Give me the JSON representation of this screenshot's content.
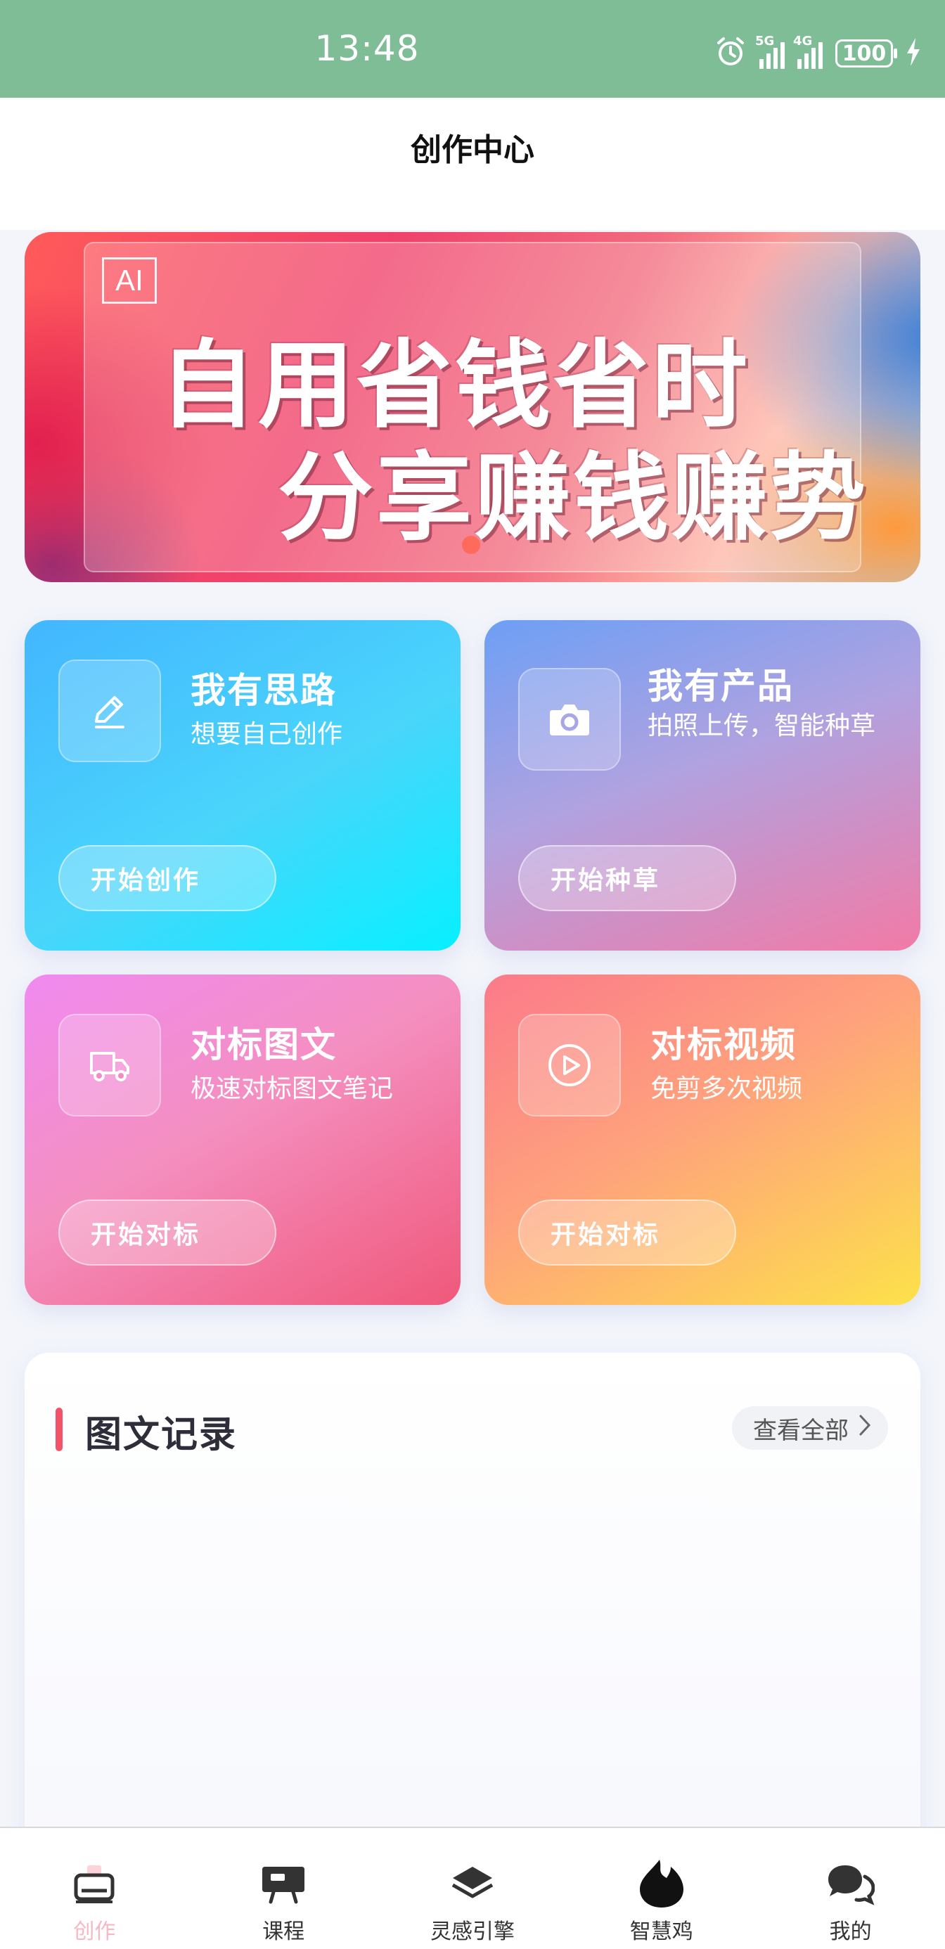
{
  "status_bar": {
    "time": "13:48",
    "network_1": "5G",
    "network_2": "4G",
    "battery": "100",
    "icons": [
      "alarm-icon",
      "signal-icon",
      "battery-icon",
      "charging-icon"
    ]
  },
  "header": {
    "title": "创作中心"
  },
  "banner": {
    "badge": "AI",
    "line1": "自用省钱省时",
    "line2": "分享赚钱赚势",
    "indicator_dot_color": "#ff6b5b"
  },
  "cards": [
    {
      "title": "我有思路",
      "subtitle": "想要自己创作",
      "button": "开始创作",
      "icon": "pencil-icon"
    },
    {
      "title": "我有产品",
      "subtitle": "拍照上传，智能种草",
      "button": "开始种草",
      "icon": "camera-icon"
    },
    {
      "title": "对标图文",
      "subtitle": "极速对标图文笔记",
      "button": "开始对标",
      "icon": "truck-icon"
    },
    {
      "title": "对标视频",
      "subtitle": "免剪多次视频",
      "button": "开始对标",
      "icon": "play-icon"
    }
  ],
  "records": {
    "title": "图文记录",
    "view_all": "查看全部",
    "accent_color": "#f2536b"
  },
  "bottom_nav": {
    "items": [
      {
        "label": "创作",
        "icon": "create-icon",
        "active": true
      },
      {
        "label": "课程",
        "icon": "course-icon",
        "active": false
      },
      {
        "label": "灵感引擎",
        "icon": "layers-icon",
        "active": false
      },
      {
        "label": "智慧鸡",
        "icon": "flame-icon",
        "active": false
      },
      {
        "label": "我的",
        "icon": "chat-icon",
        "active": false
      }
    ],
    "active_color": "#f7b8c2"
  }
}
